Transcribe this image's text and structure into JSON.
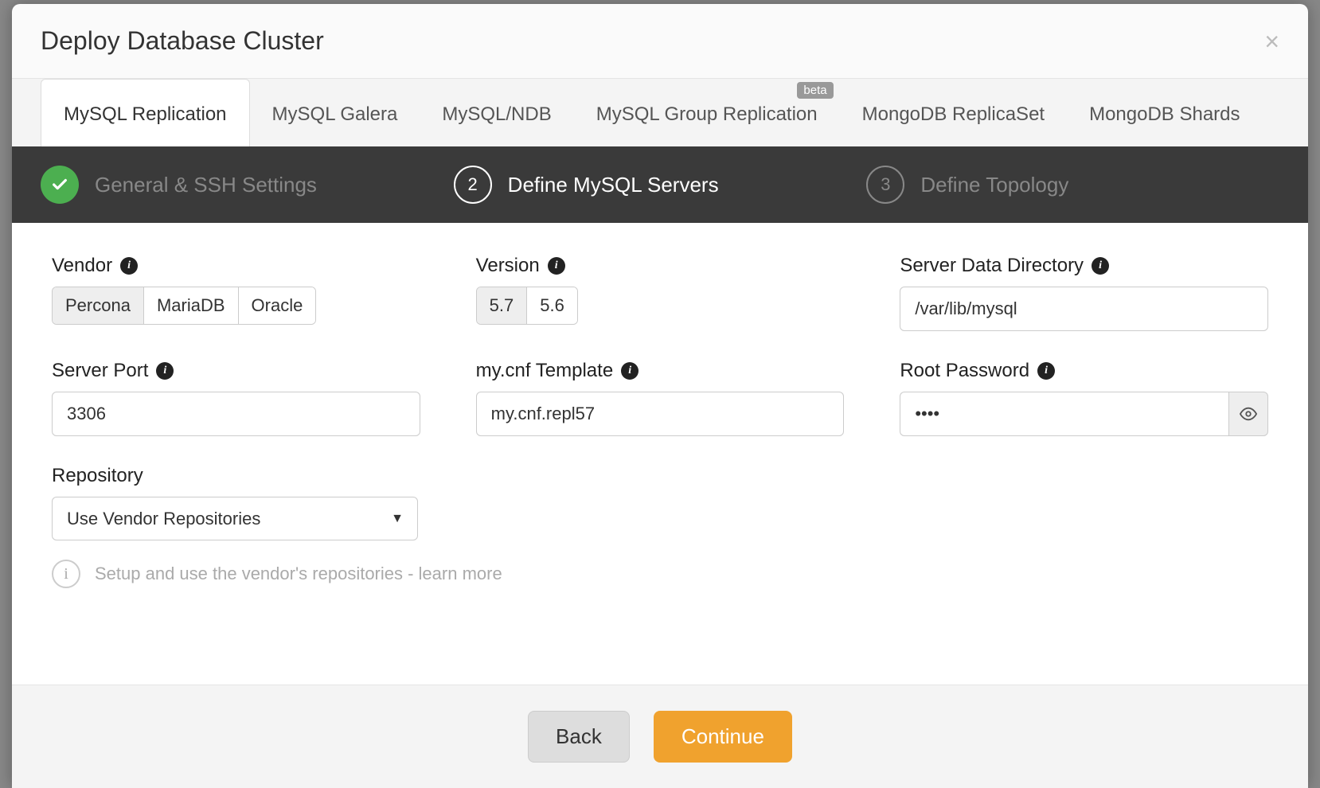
{
  "modal": {
    "title": "Deploy Database Cluster"
  },
  "tabs": {
    "t0": "MySQL Replication",
    "t1": "MySQL Galera",
    "t2": "MySQL/NDB",
    "t3": "MySQL Group Replication",
    "t3_badge": "beta",
    "t4": "MongoDB ReplicaSet",
    "t5": "MongoDB Shards"
  },
  "steps": {
    "s1": "General & SSH Settings",
    "s2_num": "2",
    "s2": "Define MySQL Servers",
    "s3_num": "3",
    "s3": "Define Topology"
  },
  "labels": {
    "vendor": "Vendor",
    "version": "Version",
    "data_dir": "Server Data Directory",
    "server_port": "Server Port",
    "mycnf": "my.cnf Template",
    "root_pw": "Root Password",
    "repository": "Repository"
  },
  "vendor": {
    "opt0": "Percona",
    "opt1": "MariaDB",
    "opt2": "Oracle",
    "selected": "Percona"
  },
  "version": {
    "opt0": "5.7",
    "opt1": "5.6",
    "selected": "5.7"
  },
  "values": {
    "data_dir": "/var/lib/mysql",
    "server_port": "3306",
    "mycnf": "my.cnf.repl57",
    "root_pw": "••••",
    "repository": "Use Vendor Repositories"
  },
  "hint": "Setup and use the vendor's repositories - learn more",
  "footer": {
    "back": "Back",
    "continue": "Continue"
  }
}
